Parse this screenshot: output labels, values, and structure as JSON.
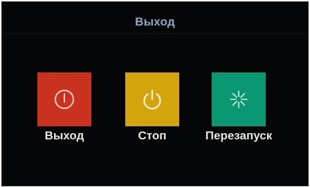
{
  "dialog": {
    "title": "Выход"
  },
  "actions": [
    {
      "label": "Выход",
      "icon": "power-circle-icon",
      "color": "#c8321f"
    },
    {
      "label": "Стоп",
      "icon": "power-icon",
      "color": "#d4a40c"
    },
    {
      "label": "Перезапуск",
      "icon": "asterisk-spark-icon",
      "color": "#0a9873"
    }
  ],
  "colors": {
    "background": "#050608",
    "title": "#8fa8c4",
    "label": "#e6e6e6"
  }
}
